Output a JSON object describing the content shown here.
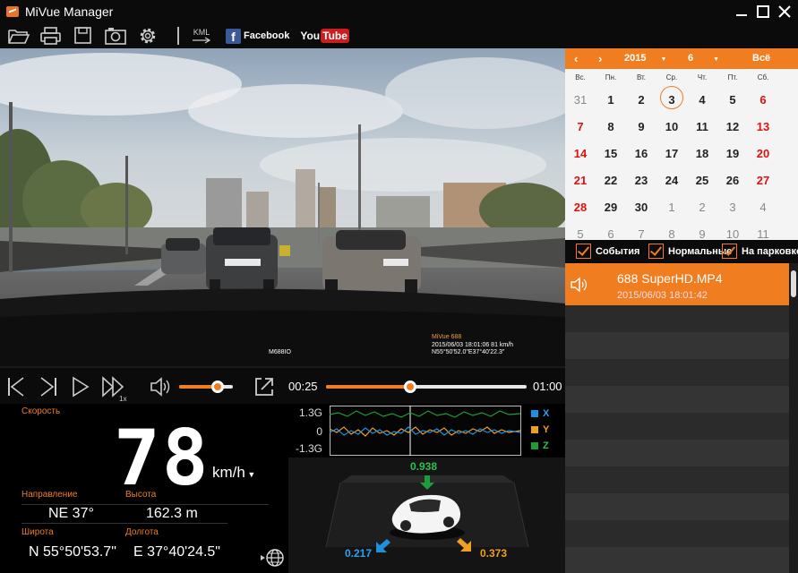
{
  "app": {
    "title": "MiVue Manager"
  },
  "toolbar": {
    "kml_label": "KML",
    "facebook_label": "Facebook",
    "youtube_you": "You",
    "youtube_tube": "Tube"
  },
  "video": {
    "stamp_brand": "MiVue 688",
    "stamp_datetime": "2015/06/03 18:01:06  81 km/h",
    "stamp_coords": "N55°50'52.0\"E37°40'22.3\"",
    "model_label": "M688IO",
    "car_plate_left": "О552ТК",
    "car_plate_right": "О400ТО"
  },
  "playback": {
    "speed_label": "1x",
    "current_time": "00:25",
    "total_time": "01:00",
    "volume_level": 0.72,
    "progress": 0.42
  },
  "gauges": {
    "speed_label": "Скорость",
    "speed_value": "78",
    "speed_unit": "km/h",
    "direction_label": "Направление",
    "direction_value": "NE 37°",
    "altitude_label": "Высота",
    "altitude_value": "162.3  m",
    "latitude_label": "Широта",
    "latitude_value": "N 55°50'53.7\"",
    "longitude_label": "Долгота",
    "longitude_value": "E 37°40'24.5\""
  },
  "gsensor": {
    "y_top": "1.3G",
    "y_mid": "0",
    "y_bottom": "-1.3G",
    "legend": [
      {
        "name": "X",
        "color": "#1e90e0"
      },
      {
        "name": "Y",
        "color": "#f0a020"
      },
      {
        "name": "Z",
        "color": "#1e9b3a"
      }
    ],
    "z_value": "0.938",
    "x_value": "0.217",
    "y_value": "0.373"
  },
  "calendar": {
    "year": "2015",
    "month": "6",
    "all_label": "Всё",
    "weekdays": [
      "Вс.",
      "Пн.",
      "Вт.",
      "Ср.",
      "Чт.",
      "Пт.",
      "Сб."
    ],
    "weeks": [
      [
        "31",
        "1",
        "2",
        "3",
        "4",
        "5",
        "6"
      ],
      [
        "7",
        "8",
        "9",
        "10",
        "11",
        "12",
        "13"
      ],
      [
        "14",
        "15",
        "16",
        "17",
        "18",
        "19",
        "20"
      ],
      [
        "21",
        "22",
        "23",
        "24",
        "25",
        "26",
        "27"
      ],
      [
        "28",
        "29",
        "30",
        "1",
        "2",
        "3",
        "4"
      ],
      [
        "5",
        "6",
        "7",
        "8",
        "9",
        "10",
        "11"
      ]
    ],
    "selected_day": "3"
  },
  "filters": [
    {
      "label": "События",
      "checked": true
    },
    {
      "label": "Нормальные",
      "checked": true
    },
    {
      "label": "На парковке",
      "checked": true
    }
  ],
  "files": [
    {
      "name": "688 SuperHD.MP4",
      "date": "2015/06/03    18:01:42",
      "selected": true
    }
  ],
  "colors": {
    "accent": "#f07d20",
    "background": "#0b0b0b",
    "list_bg": "#2b2b2b"
  }
}
